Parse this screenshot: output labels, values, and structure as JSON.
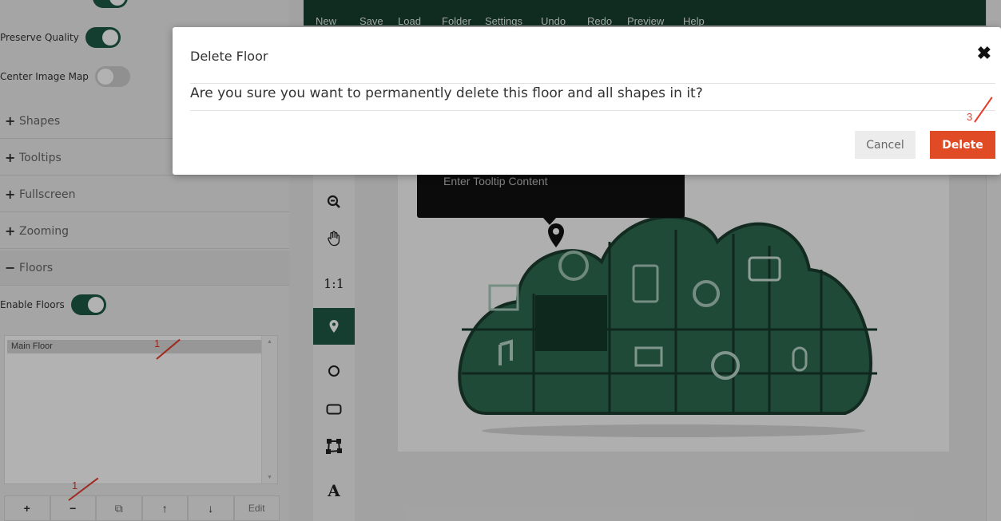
{
  "settings": {
    "preserve_quality": {
      "label": "Preserve Quality",
      "on": true
    },
    "center_image_map": {
      "label": "Center Image Map",
      "on": false
    },
    "enable_floors": {
      "label": "Enable Floors",
      "on": true
    }
  },
  "sections": [
    {
      "symbol": "+",
      "label": "Shapes"
    },
    {
      "symbol": "+",
      "label": "Tooltips"
    },
    {
      "symbol": "+",
      "label": "Fullscreen"
    },
    {
      "symbol": "+",
      "label": "Zooming"
    },
    {
      "symbol": "−",
      "label": "Floors"
    }
  ],
  "floors": {
    "items": [
      "Main Floor"
    ]
  },
  "floor_tools": {
    "add": "+",
    "remove": "−",
    "duplicate": "⧉",
    "up": "↑",
    "down": "↓",
    "edit": "Edit"
  },
  "top_toolbar": [
    "New",
    "Save",
    "Load",
    "Folder",
    "Settings",
    "Undo",
    "Redo",
    "Preview",
    "Help"
  ],
  "side_tools": {
    "zoom_out": "zoom-out-icon",
    "pan": "hand-icon",
    "reset": "1:1",
    "pin": "pin-icon",
    "circle": "circle-icon",
    "rect": "rect-icon",
    "poly": "poly-icon",
    "text": "A"
  },
  "tooltip": {
    "content": "Enter Tooltip Content"
  },
  "annotations": {
    "step1": "1",
    "step2": "1",
    "step3": "3"
  },
  "modal": {
    "title": "Delete Floor",
    "message": "Are you sure you want to permanently delete this floor and all shapes in it?",
    "cancel": "Cancel",
    "delete": "Delete",
    "close": "✖"
  },
  "colors": {
    "accent": "#1e5a44",
    "danger": "#e04a24",
    "annotation": "#e53b2c"
  }
}
